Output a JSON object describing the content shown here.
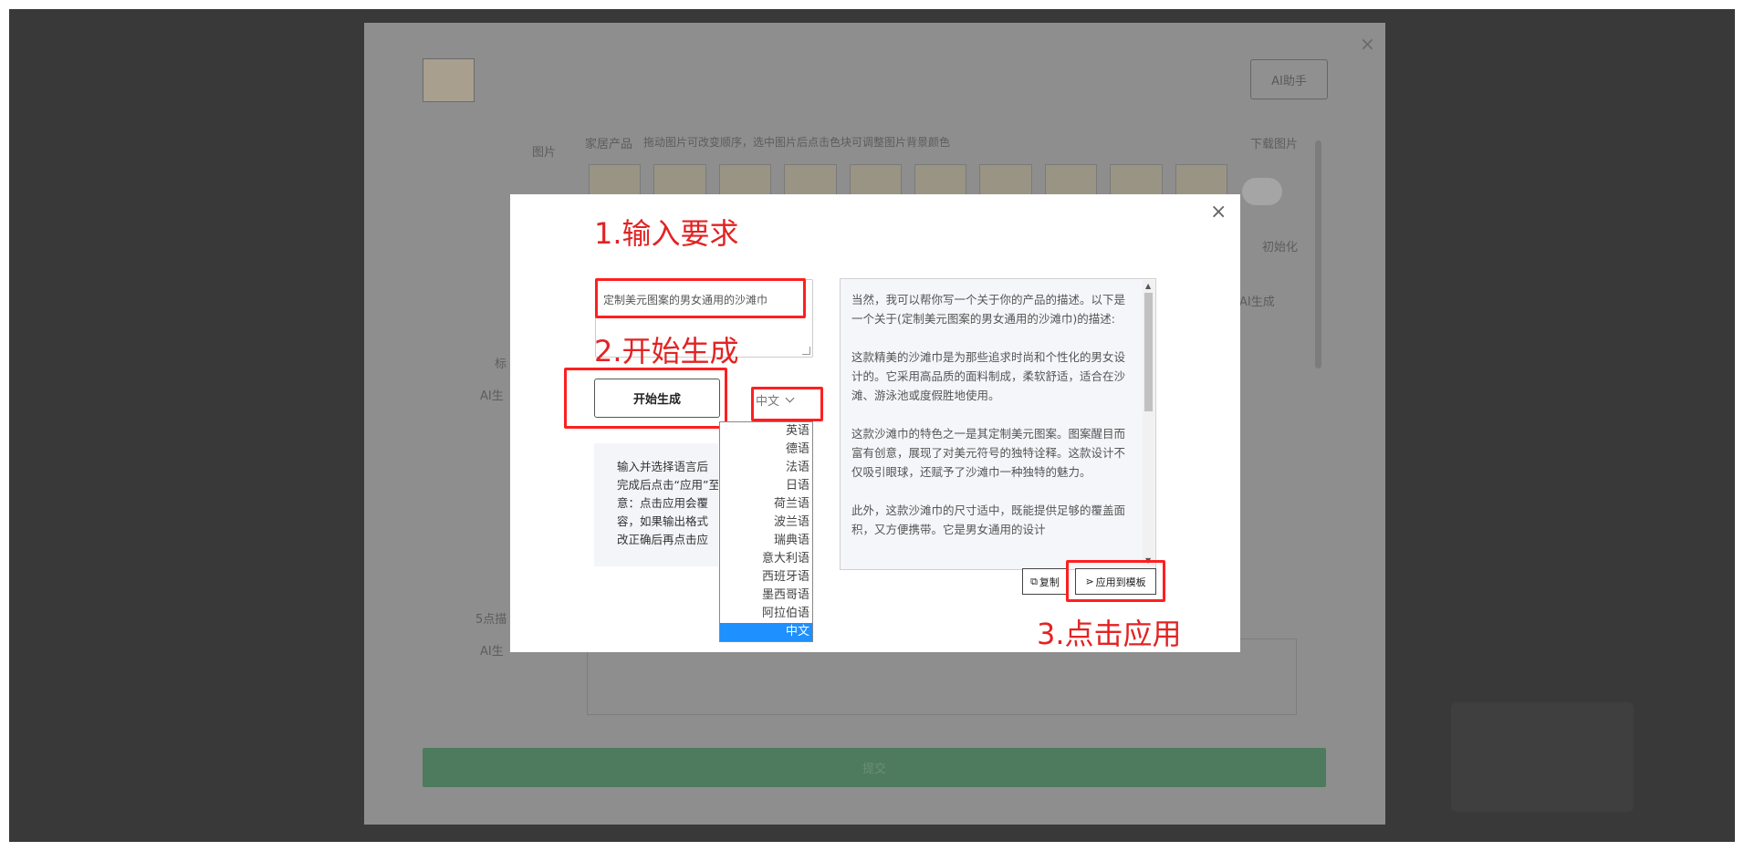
{
  "background": {
    "ai_assistant_button": "AI助手",
    "image_label": "图片",
    "category_label": "家居产品",
    "category_hint": "拖动图片可改变顺序，选中图片后点击色块可调整图片背景颜色",
    "download_images": "下载图片",
    "init_label": "初始化",
    "ai_generate_label": "AI生成",
    "ai_label_1": "AI生",
    "title_label": "标",
    "five_points_label": "5点描",
    "ai_label_2": "AI生",
    "submit_button": "提交"
  },
  "modal": {
    "close_icon": "close-icon",
    "step1": "1.输入要求",
    "requirement_input_value": "定制美元图案的男女通用的沙滩巾",
    "step2": "2.开始生成",
    "start_button": "开始生成",
    "language_selected": "中文",
    "language_options": [
      "英语",
      "德语",
      "法语",
      "日语",
      "荷兰语",
      "波兰语",
      "瑞典语",
      "意大利语",
      "西班牙语",
      "墨西哥语",
      "阿拉伯语",
      "中文"
    ],
    "hint_lines": [
      "输入并选择语言后",
      "完成后点击“应用”至",
      "意：点击应用会覆",
      "容，如果输出格式",
      "改正确后再点击应"
    ],
    "output_paragraphs": [
      "当然，我可以帮你写一个关于你的产品的描述。以下是一个关于(定制美元图案的男女通用的沙滩巾)的描述:",
      "这款精美的沙滩巾是为那些追求时尚和个性化的男女设计的。它采用高品质的面料制成，柔软舒适，适合在沙滩、游泳池或度假胜地使用。",
      "这款沙滩巾的特色之一是其定制美元图案。图案醒目而富有创意，展现了对美元符号的独特诠释。这款设计不仅吸引眼球，还赋予了沙滩巾一种独特的魅力。",
      "此外，这款沙滩巾的尺寸适中，既能提供足够的覆盖面积，又方便携带。它是男女通用的设计"
    ],
    "copy_button": "复制",
    "apply_button": "应用到模板",
    "step3": "3.点击应用"
  }
}
